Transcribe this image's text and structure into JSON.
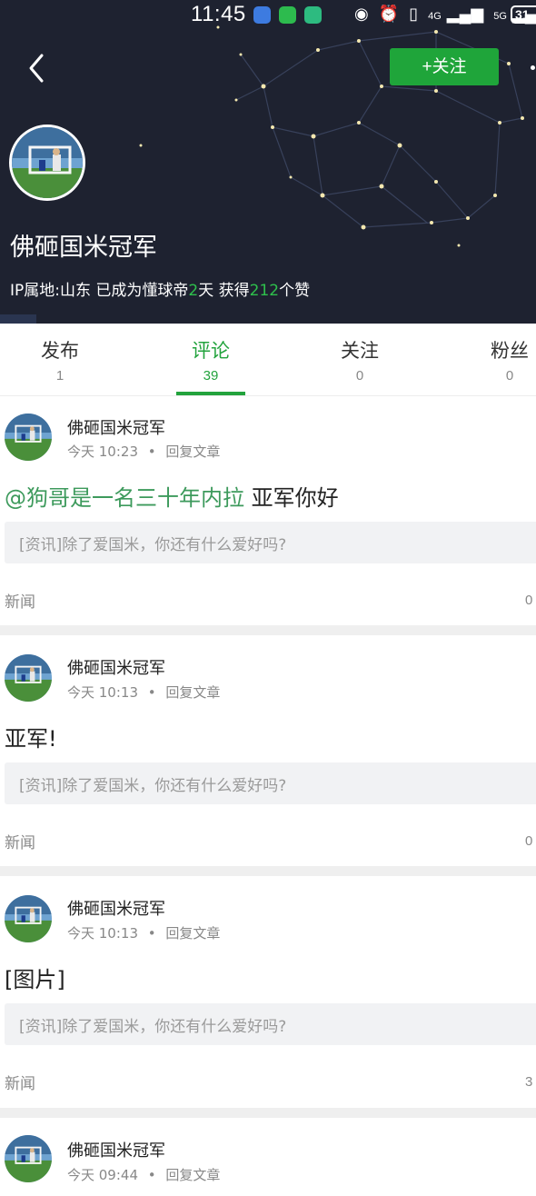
{
  "status_bar": {
    "time": "11:45",
    "network": "4G",
    "network2": "5G",
    "battery": "31"
  },
  "header": {
    "back_icon": "chevron-left-icon",
    "follow_label": "+关注",
    "user_name": "佛砸国米冠军",
    "meta_prefix": "IP属地:山东 已成为懂球帝",
    "meta_days": "2",
    "meta_mid": "天 获得",
    "meta_likes": "212",
    "meta_suffix": "个赞",
    "accent": "#1fa53a"
  },
  "tabs": [
    {
      "label": "发布",
      "count": "1"
    },
    {
      "label": "评论",
      "count": "39"
    },
    {
      "label": "关注",
      "count": "0"
    },
    {
      "label": "粉丝",
      "count": "0"
    }
  ],
  "active_tab": "评论",
  "comments": [
    {
      "name": "佛砸国米冠军",
      "time": "今天 10:23",
      "action": "回复文章",
      "mention": "@狗哥是一名三十年内拉",
      "text": " 亚军你好",
      "quote": "[资讯]除了爱国米，你还有什么爱好吗?",
      "category": "新闻",
      "count": "0"
    },
    {
      "name": "佛砸国米冠军",
      "time": "今天 10:13",
      "action": "回复文章",
      "mention": "",
      "text": "亚军!",
      "quote": "[资讯]除了爱国米，你还有什么爱好吗?",
      "category": "新闻",
      "count": "0"
    },
    {
      "name": "佛砸国米冠军",
      "time": "今天 10:13",
      "action": "回复文章",
      "mention": "",
      "text": "[图片]",
      "quote": "[资讯]除了爱国米，你还有什么爱好吗?",
      "category": "新闻",
      "count": "3"
    },
    {
      "name": "佛砸国米冠军",
      "time": "今天 09:44",
      "action": "回复文章",
      "mention": "",
      "text": "",
      "quote": "",
      "category": "",
      "count": ""
    }
  ]
}
